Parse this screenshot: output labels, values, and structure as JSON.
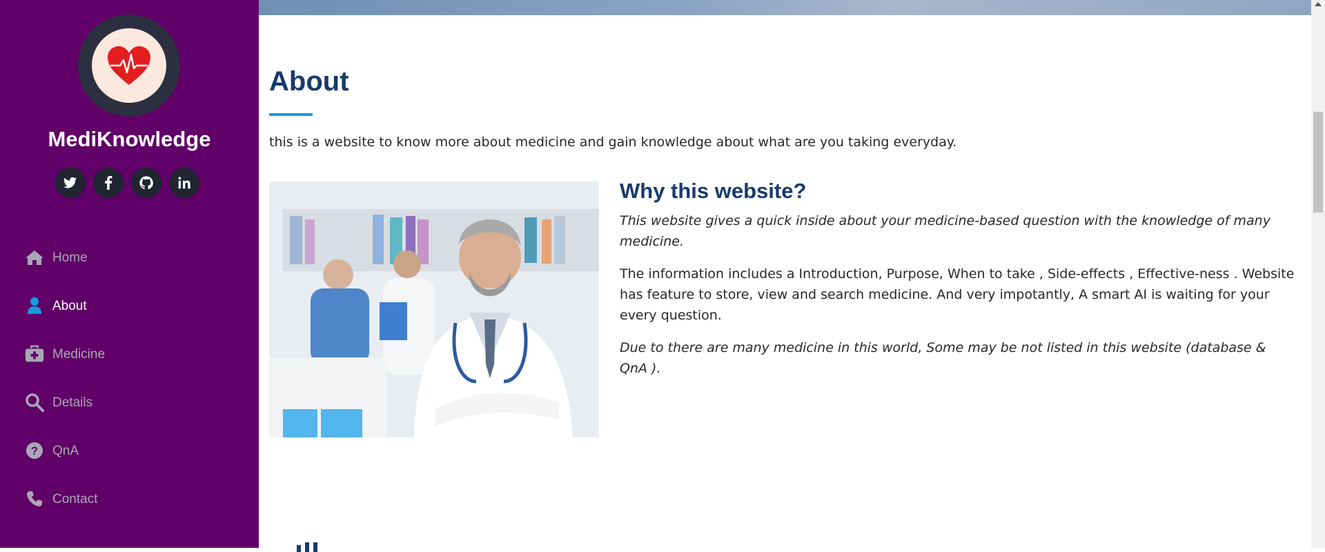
{
  "brand": {
    "name": "MediKnowledge"
  },
  "social": [
    {
      "name": "twitter",
      "glyph": "t"
    },
    {
      "name": "facebook",
      "glyph": "f"
    },
    {
      "name": "github",
      "glyph": "g"
    },
    {
      "name": "linkedin",
      "glyph": "in"
    }
  ],
  "nav": {
    "items": [
      {
        "label": "Home",
        "icon": "home-icon"
      },
      {
        "label": "About",
        "icon": "user-icon",
        "active": true
      },
      {
        "label": "Medicine",
        "icon": "medkit-icon"
      },
      {
        "label": "Details",
        "icon": "search-icon"
      },
      {
        "label": "QnA",
        "icon": "question-icon"
      },
      {
        "label": "Contact",
        "icon": "phone-icon"
      }
    ]
  },
  "about": {
    "title": "About",
    "intro": "this is a website to know more about medicine and gain knowledge about what are you taking everyday.",
    "subtitle": "Why this website?",
    "p1": "This website gives a quick inside about your medicine-based question with the knowledge of many medicine.",
    "p2": "The information includes a Introduction, Purpose, When to take , Side-effects , Effective-ness . Website has feature to store, view and search medicine. And very impotantly, A smart AI is waiting for your every question.",
    "p3": "Due to there are many medicine in this world, Some may be not listed in this website (database & QnA )."
  },
  "colors": {
    "sidebar": "#600068",
    "heading": "#173b6c",
    "accent": "#149ddd",
    "logo_heart": "#e41e1e"
  }
}
